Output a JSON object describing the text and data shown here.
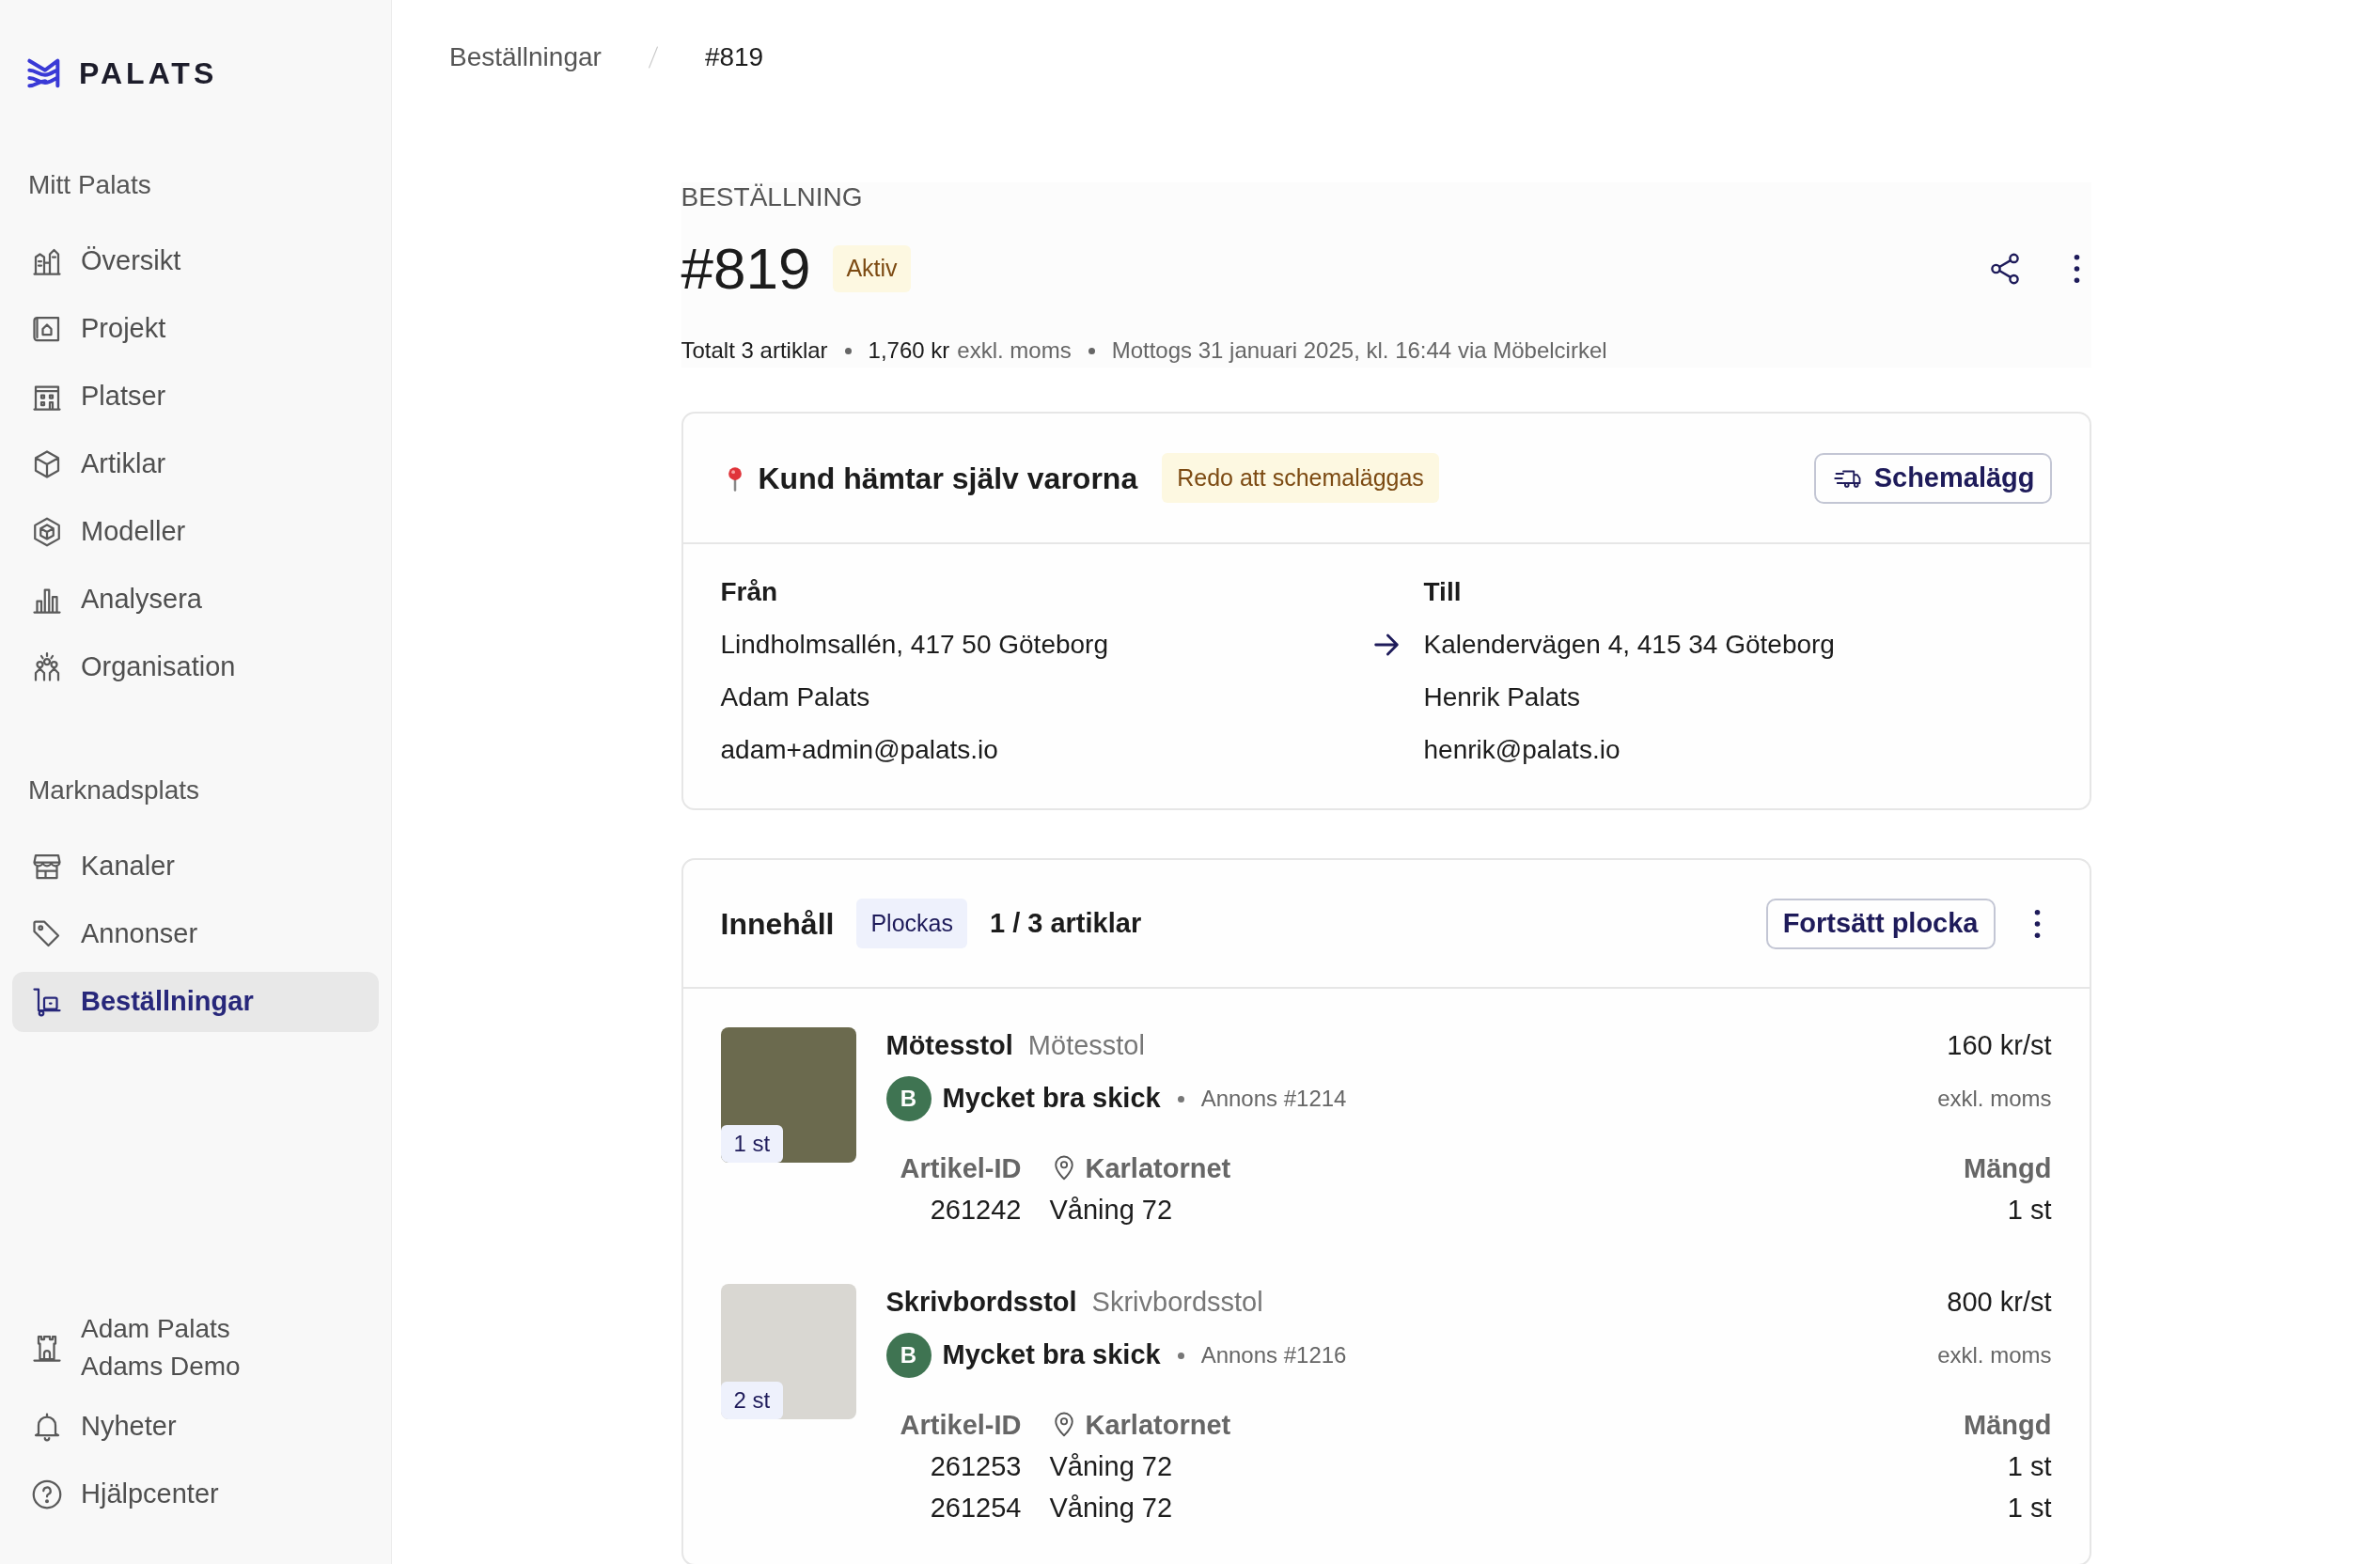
{
  "sidebar": {
    "logo": "PALATS",
    "sections": [
      {
        "title": "Mitt Palats",
        "items": [
          {
            "label": "Översikt",
            "selected": false
          },
          {
            "label": "Projekt",
            "selected": false
          },
          {
            "label": "Platser",
            "selected": false
          },
          {
            "label": "Artiklar",
            "selected": false
          },
          {
            "label": "Modeller",
            "selected": false
          },
          {
            "label": "Analysera",
            "selected": false
          },
          {
            "label": "Organisation",
            "selected": false
          }
        ]
      },
      {
        "title": "Marknadsplats",
        "items": [
          {
            "label": "Kanaler",
            "selected": false
          },
          {
            "label": "Annonser",
            "selected": false
          },
          {
            "label": "Beställningar",
            "selected": true
          }
        ]
      }
    ],
    "footer": {
      "account": {
        "name": "Adam Palats",
        "org": "Adams Demo"
      },
      "items": [
        {
          "label": "Nyheter"
        },
        {
          "label": "Hjälpcenter"
        }
      ]
    }
  },
  "breadcrumb": [
    "Beställningar",
    "#819"
  ],
  "order": {
    "eyebrow": "BESTÄLLNING",
    "number": "#819",
    "status": "Aktiv",
    "summary": {
      "items": "Totalt 3 artiklar",
      "price": "1,760 kr",
      "price_note": "exkl. moms",
      "received": "Mottogs 31 januari 2025, kl. 16:44 via Möbelcirkel"
    }
  },
  "delivery": {
    "title": "Kund hämtar själv varorna",
    "status": "Redo att schemaläggas",
    "button": "Schemalägg",
    "from": {
      "label": "Från",
      "address": "Lindholmsallén, 417 50 Göteborg",
      "name": "Adam Palats",
      "email": "adam+admin@palats.io"
    },
    "to": {
      "label": "Till",
      "address": "Kalendervägen 4, 415 34 Göteborg",
      "name": "Henrik Palats",
      "email": "henrik@palats.io"
    }
  },
  "contents": {
    "title": "Innehåll",
    "status": "Plockas",
    "progress": "1 / 3 artiklar",
    "button": "Fortsätt plocka",
    "items": [
      {
        "name": "Mötesstol",
        "model": "Mötesstol",
        "quantity_badge": "1 st",
        "grade": "B",
        "condition": "Mycket bra skick",
        "listing": "Annons #1214",
        "price": "160 kr/st",
        "price_note": "exkl. moms",
        "id_header": "Artikel-ID",
        "location": "Karlatornet",
        "quantity_header": "Mängd",
        "units": [
          {
            "id": "261242",
            "floor": "Våning 72",
            "quantity": "1 st"
          }
        ]
      },
      {
        "name": "Skrivbordsstol",
        "model": "Skrivbordsstol",
        "quantity_badge": "2 st",
        "grade": "B",
        "condition": "Mycket bra skick",
        "listing": "Annons #1216",
        "price": "800 kr/st",
        "price_note": "exkl. moms",
        "id_header": "Artikel-ID",
        "location": "Karlatornet",
        "quantity_header": "Mängd",
        "units": [
          {
            "id": "261253",
            "floor": "Våning 72",
            "quantity": "1 st"
          },
          {
            "id": "261254",
            "floor": "Våning 72",
            "quantity": "1 st"
          }
        ]
      }
    ]
  }
}
